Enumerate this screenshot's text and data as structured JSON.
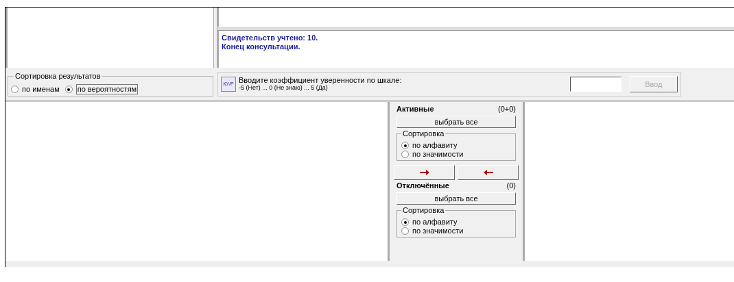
{
  "log": {
    "lines": [
      "Свидетельств учтено: 10.",
      "Конец консультации."
    ]
  },
  "results_sort": {
    "title": "Сортировка результатов",
    "options": [
      {
        "label": "по именам",
        "selected": false
      },
      {
        "label": "по вероятностям",
        "selected": true
      }
    ]
  },
  "input_bar": {
    "icon_text": "КУ/Р",
    "prompt": "Вводите коэффициент уверенности по шкале:",
    "scale": "-5 (Нет) ... 0 (Не знаю) ... 5 (Да)",
    "submit": {
      "label": "Ввод",
      "disabled": true
    }
  },
  "active": {
    "title": "Активные",
    "count": "(0+0)",
    "select_all": "выбрать все",
    "sort_title": "Сортировка",
    "options": [
      {
        "label": "по алфавиту",
        "selected": true
      },
      {
        "label": "по значимости",
        "selected": false
      }
    ]
  },
  "move_buttons": [
    {
      "kind": "right"
    },
    {
      "kind": "left"
    }
  ],
  "disabled_list": {
    "title": "Отключённые",
    "count": "(0)",
    "select_all": "выбрать все",
    "sort_title": "Сортировка",
    "options": [
      {
        "label": "по алфавиту",
        "selected": true
      },
      {
        "label": "по значимости",
        "selected": false
      }
    ]
  }
}
